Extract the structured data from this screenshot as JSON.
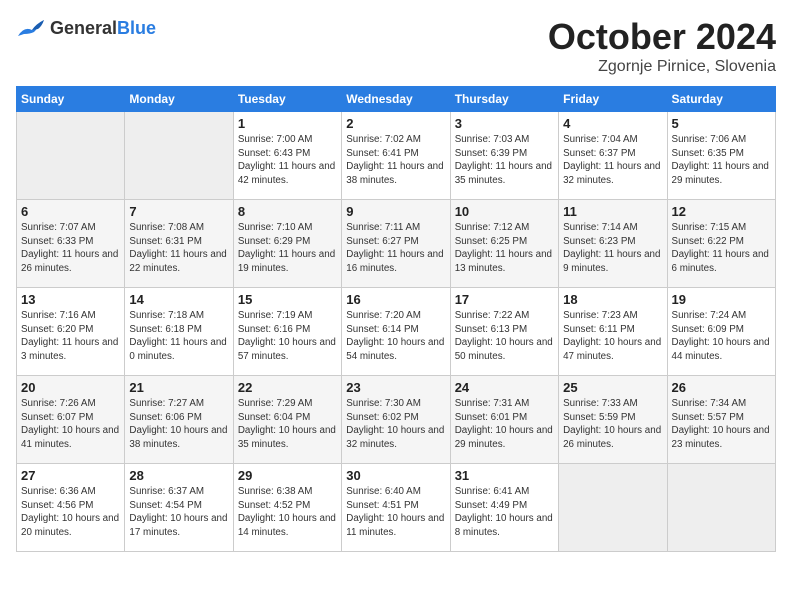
{
  "header": {
    "logo": {
      "general": "General",
      "blue": "Blue"
    },
    "title": "October 2024",
    "location": "Zgornje Pirnice, Slovenia"
  },
  "weekdays": [
    "Sunday",
    "Monday",
    "Tuesday",
    "Wednesday",
    "Thursday",
    "Friday",
    "Saturday"
  ],
  "weeks": [
    [
      {
        "day": "",
        "empty": true
      },
      {
        "day": "",
        "empty": true
      },
      {
        "day": "1",
        "sunrise": "Sunrise: 7:00 AM",
        "sunset": "Sunset: 6:43 PM",
        "daylight": "Daylight: 11 hours and 42 minutes."
      },
      {
        "day": "2",
        "sunrise": "Sunrise: 7:02 AM",
        "sunset": "Sunset: 6:41 PM",
        "daylight": "Daylight: 11 hours and 38 minutes."
      },
      {
        "day": "3",
        "sunrise": "Sunrise: 7:03 AM",
        "sunset": "Sunset: 6:39 PM",
        "daylight": "Daylight: 11 hours and 35 minutes."
      },
      {
        "day": "4",
        "sunrise": "Sunrise: 7:04 AM",
        "sunset": "Sunset: 6:37 PM",
        "daylight": "Daylight: 11 hours and 32 minutes."
      },
      {
        "day": "5",
        "sunrise": "Sunrise: 7:06 AM",
        "sunset": "Sunset: 6:35 PM",
        "daylight": "Daylight: 11 hours and 29 minutes."
      }
    ],
    [
      {
        "day": "6",
        "sunrise": "Sunrise: 7:07 AM",
        "sunset": "Sunset: 6:33 PM",
        "daylight": "Daylight: 11 hours and 26 minutes."
      },
      {
        "day": "7",
        "sunrise": "Sunrise: 7:08 AM",
        "sunset": "Sunset: 6:31 PM",
        "daylight": "Daylight: 11 hours and 22 minutes."
      },
      {
        "day": "8",
        "sunrise": "Sunrise: 7:10 AM",
        "sunset": "Sunset: 6:29 PM",
        "daylight": "Daylight: 11 hours and 19 minutes."
      },
      {
        "day": "9",
        "sunrise": "Sunrise: 7:11 AM",
        "sunset": "Sunset: 6:27 PM",
        "daylight": "Daylight: 11 hours and 16 minutes."
      },
      {
        "day": "10",
        "sunrise": "Sunrise: 7:12 AM",
        "sunset": "Sunset: 6:25 PM",
        "daylight": "Daylight: 11 hours and 13 minutes."
      },
      {
        "day": "11",
        "sunrise": "Sunrise: 7:14 AM",
        "sunset": "Sunset: 6:23 PM",
        "daylight": "Daylight: 11 hours and 9 minutes."
      },
      {
        "day": "12",
        "sunrise": "Sunrise: 7:15 AM",
        "sunset": "Sunset: 6:22 PM",
        "daylight": "Daylight: 11 hours and 6 minutes."
      }
    ],
    [
      {
        "day": "13",
        "sunrise": "Sunrise: 7:16 AM",
        "sunset": "Sunset: 6:20 PM",
        "daylight": "Daylight: 11 hours and 3 minutes."
      },
      {
        "day": "14",
        "sunrise": "Sunrise: 7:18 AM",
        "sunset": "Sunset: 6:18 PM",
        "daylight": "Daylight: 11 hours and 0 minutes."
      },
      {
        "day": "15",
        "sunrise": "Sunrise: 7:19 AM",
        "sunset": "Sunset: 6:16 PM",
        "daylight": "Daylight: 10 hours and 57 minutes."
      },
      {
        "day": "16",
        "sunrise": "Sunrise: 7:20 AM",
        "sunset": "Sunset: 6:14 PM",
        "daylight": "Daylight: 10 hours and 54 minutes."
      },
      {
        "day": "17",
        "sunrise": "Sunrise: 7:22 AM",
        "sunset": "Sunset: 6:13 PM",
        "daylight": "Daylight: 10 hours and 50 minutes."
      },
      {
        "day": "18",
        "sunrise": "Sunrise: 7:23 AM",
        "sunset": "Sunset: 6:11 PM",
        "daylight": "Daylight: 10 hours and 47 minutes."
      },
      {
        "day": "19",
        "sunrise": "Sunrise: 7:24 AM",
        "sunset": "Sunset: 6:09 PM",
        "daylight": "Daylight: 10 hours and 44 minutes."
      }
    ],
    [
      {
        "day": "20",
        "sunrise": "Sunrise: 7:26 AM",
        "sunset": "Sunset: 6:07 PM",
        "daylight": "Daylight: 10 hours and 41 minutes."
      },
      {
        "day": "21",
        "sunrise": "Sunrise: 7:27 AM",
        "sunset": "Sunset: 6:06 PM",
        "daylight": "Daylight: 10 hours and 38 minutes."
      },
      {
        "day": "22",
        "sunrise": "Sunrise: 7:29 AM",
        "sunset": "Sunset: 6:04 PM",
        "daylight": "Daylight: 10 hours and 35 minutes."
      },
      {
        "day": "23",
        "sunrise": "Sunrise: 7:30 AM",
        "sunset": "Sunset: 6:02 PM",
        "daylight": "Daylight: 10 hours and 32 minutes."
      },
      {
        "day": "24",
        "sunrise": "Sunrise: 7:31 AM",
        "sunset": "Sunset: 6:01 PM",
        "daylight": "Daylight: 10 hours and 29 minutes."
      },
      {
        "day": "25",
        "sunrise": "Sunrise: 7:33 AM",
        "sunset": "Sunset: 5:59 PM",
        "daylight": "Daylight: 10 hours and 26 minutes."
      },
      {
        "day": "26",
        "sunrise": "Sunrise: 7:34 AM",
        "sunset": "Sunset: 5:57 PM",
        "daylight": "Daylight: 10 hours and 23 minutes."
      }
    ],
    [
      {
        "day": "27",
        "sunrise": "Sunrise: 6:36 AM",
        "sunset": "Sunset: 4:56 PM",
        "daylight": "Daylight: 10 hours and 20 minutes."
      },
      {
        "day": "28",
        "sunrise": "Sunrise: 6:37 AM",
        "sunset": "Sunset: 4:54 PM",
        "daylight": "Daylight: 10 hours and 17 minutes."
      },
      {
        "day": "29",
        "sunrise": "Sunrise: 6:38 AM",
        "sunset": "Sunset: 4:52 PM",
        "daylight": "Daylight: 10 hours and 14 minutes."
      },
      {
        "day": "30",
        "sunrise": "Sunrise: 6:40 AM",
        "sunset": "Sunset: 4:51 PM",
        "daylight": "Daylight: 10 hours and 11 minutes."
      },
      {
        "day": "31",
        "sunrise": "Sunrise: 6:41 AM",
        "sunset": "Sunset: 4:49 PM",
        "daylight": "Daylight: 10 hours and 8 minutes."
      },
      {
        "day": "",
        "empty": true
      },
      {
        "day": "",
        "empty": true
      }
    ]
  ]
}
